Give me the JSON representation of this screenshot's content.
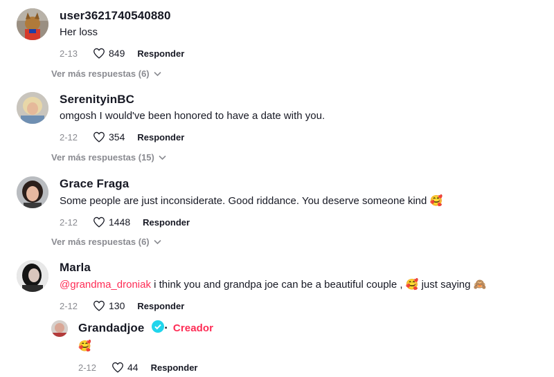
{
  "comments": [
    {
      "username": "user3621740540880",
      "text": "Her loss",
      "date": "2-13",
      "likes": "849",
      "reply_label": "Responder",
      "more_replies": "Ver más respuestas (6)"
    },
    {
      "username": "SerenityinBC",
      "text": "omgosh I would've been honored to have a date with you.",
      "date": "2-12",
      "likes": "354",
      "reply_label": "Responder",
      "more_replies": "Ver más respuestas (15)"
    },
    {
      "username": "Grace Fraga",
      "text": "Some people are just inconsiderate. Good riddance. You deserve someone kind",
      "emoji": "🥰",
      "date": "2-12",
      "likes": "1448",
      "reply_label": "Responder",
      "more_replies": "Ver más respuestas (6)"
    },
    {
      "username": "Marla",
      "mention": "@grandma_droniak",
      "text": " i think you and grandpa joe can be a beautiful couple , ",
      "emoji": "🥰",
      "text2": " just saying ",
      "emoji2": "🙈",
      "date": "2-12",
      "likes": "130",
      "reply_label": "Responder"
    }
  ],
  "reply": {
    "username": "Grandadjoe",
    "creator_label": "Creador",
    "separator": "·",
    "emoji": "🥰",
    "date": "2-12",
    "likes": "44",
    "reply_label": "Responder"
  },
  "colors": {
    "accent": "#fe2c55",
    "muted": "#8a8b91",
    "text": "#161823",
    "verified": "#20d5ec"
  },
  "icons": {
    "like": "heart-outline-icon",
    "expand": "chevron-down-icon",
    "verified": "verified-badge-icon"
  }
}
